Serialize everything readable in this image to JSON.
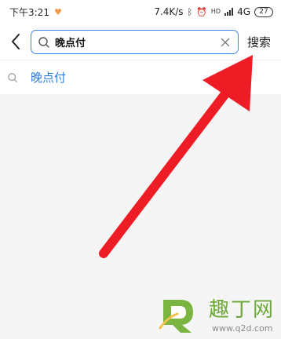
{
  "status_bar": {
    "time": "下午3:21",
    "speed": "7.4K/s",
    "network": "4G",
    "hd": "HD",
    "battery": "27"
  },
  "header": {
    "search_value": "晚点付",
    "search_button_label": "搜索"
  },
  "suggestions": [
    {
      "label": "晚点付"
    }
  ],
  "watermark": {
    "name": "趣丁网",
    "url": "www.q2d.com"
  },
  "colors": {
    "accent": "#3b86e8",
    "link": "#2f7de1",
    "arrow": "#ee1c24",
    "background": "#f5f5f5",
    "watermark": "#6fa93a"
  },
  "icons": {
    "back": "chevron-left-icon",
    "search": "search-icon",
    "clear": "close-icon",
    "status": [
      "heart-icon",
      "bluetooth-icon",
      "alarm-icon",
      "signal-icon",
      "battery-icon"
    ]
  }
}
